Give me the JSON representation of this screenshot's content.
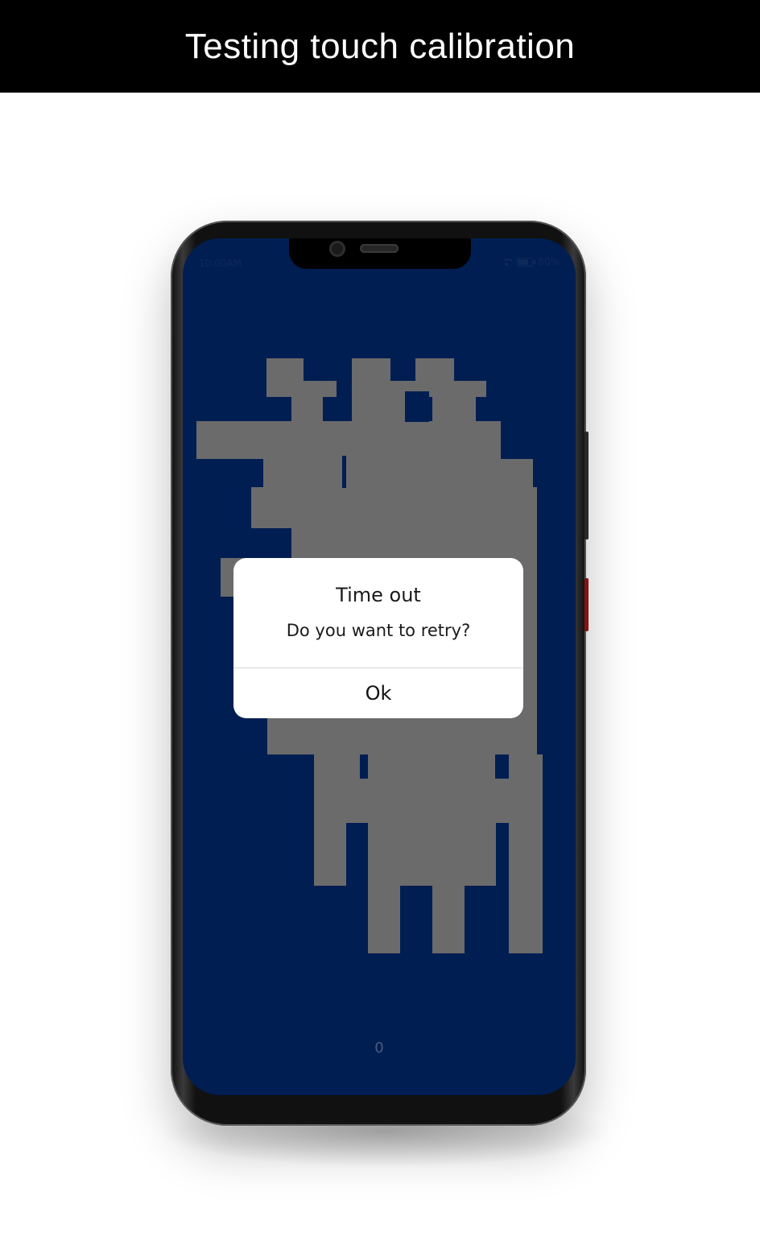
{
  "banner": {
    "title": "Testing touch calibration"
  },
  "status_bar": {
    "time": "10:00AM",
    "battery": "80%",
    "icons": [
      "wifi-icon",
      "battery-icon"
    ]
  },
  "game": {
    "score": "0",
    "figure_color": "#6b6b6b",
    "background_color": "#001e52"
  },
  "dialog": {
    "title": "Time out",
    "message": "Do you want to retry?",
    "button_label": "Ok"
  }
}
